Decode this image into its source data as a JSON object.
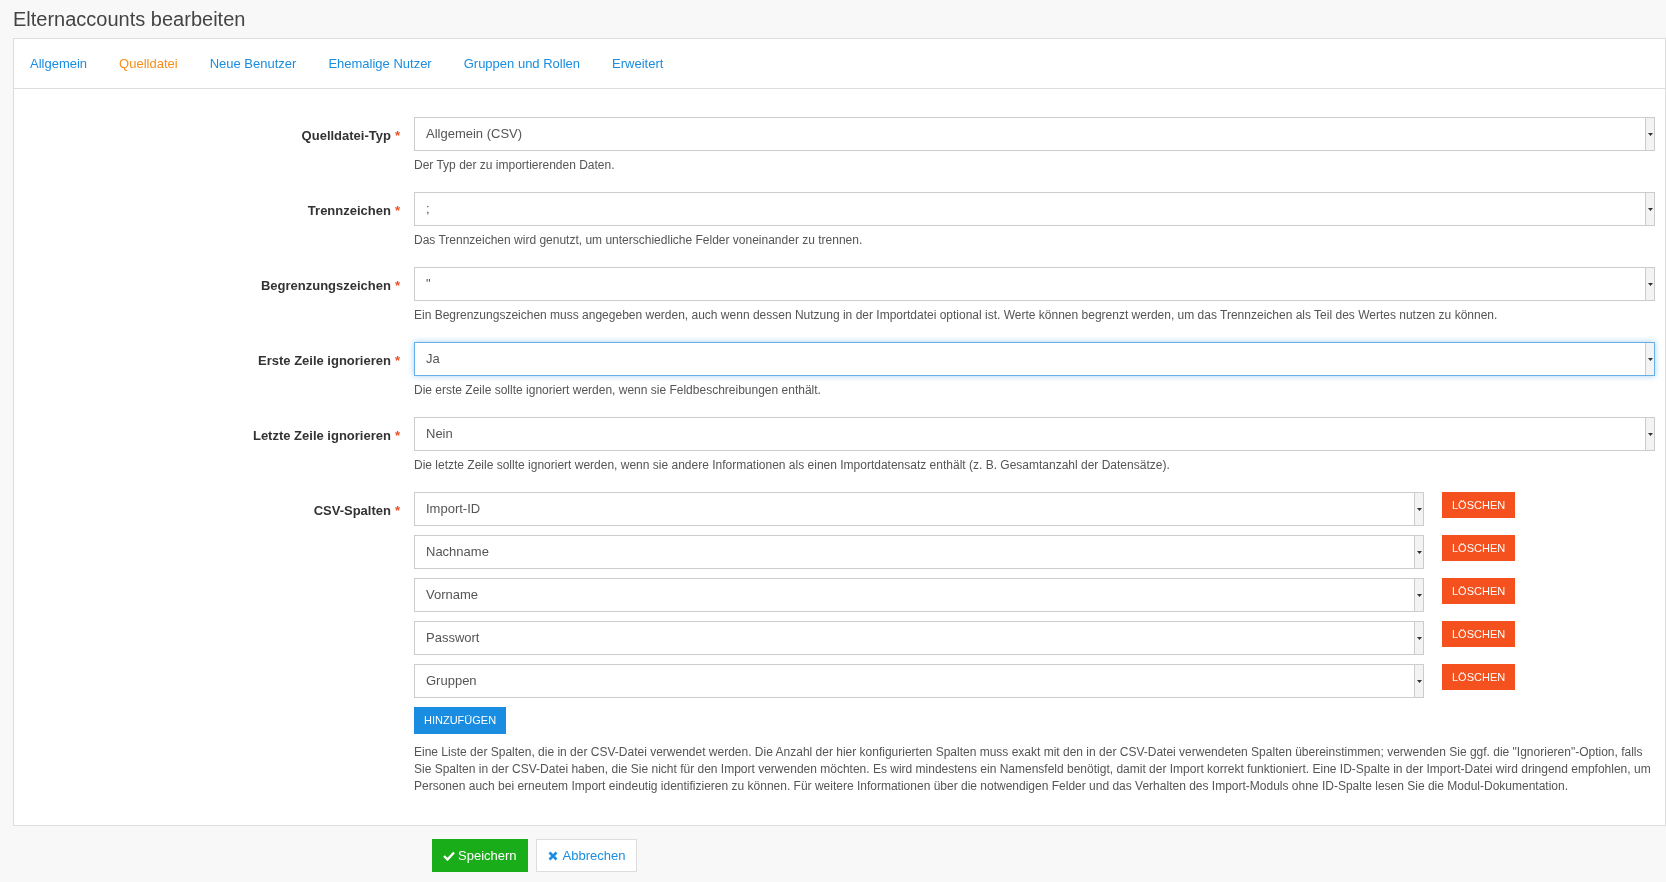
{
  "page_title": "Elternaccounts bearbeiten",
  "tabs": [
    {
      "label": "Allgemein",
      "selected": false
    },
    {
      "label": "Quelldatei",
      "selected": true
    },
    {
      "label": "Neue Benutzer",
      "selected": false
    },
    {
      "label": "Ehemalige Nutzer",
      "selected": false
    },
    {
      "label": "Gruppen und Rollen",
      "selected": false
    },
    {
      "label": "Erweitert",
      "selected": false
    }
  ],
  "fields": [
    {
      "label": "Quelldatei-Typ",
      "required": "*",
      "value": "Allgemein (CSV)",
      "focused": false,
      "help": "Der Typ der zu importierenden Daten."
    },
    {
      "label": "Trennzeichen",
      "required": "*",
      "value": ";",
      "focused": false,
      "help": "Das Trennzeichen wird genutzt, um unterschiedliche Felder voneinander zu trennen."
    },
    {
      "label": "Begrenzungszeichen",
      "required": "*",
      "value": "\"",
      "focused": false,
      "help": "Ein Begrenzungszeichen muss angegeben werden, auch wenn dessen Nutzung in der Importdatei optional ist. Werte können begrenzt werden, um das Trennzeichen als Teil des Wertes nutzen zu können."
    },
    {
      "label": "Erste Zeile ignorieren",
      "required": "*",
      "value": "Ja",
      "focused": true,
      "help": "Die erste Zeile sollte ignoriert werden, wenn sie Feldbeschreibungen enthält."
    },
    {
      "label": "Letzte Zeile ignorieren",
      "required": "*",
      "value": "Nein",
      "focused": false,
      "help": "Die letzte Zeile sollte ignoriert werden, wenn sie andere Informationen als einen Importdatensatz enthält (z. B. Gesamtanzahl der Datensätze)."
    }
  ],
  "csv_columns": {
    "label": "CSV-Spalten",
    "required": "*",
    "rows": [
      {
        "value": "Import-ID",
        "delete_button": "LÖSCHEN"
      },
      {
        "value": "Nachname",
        "delete_button": "LÖSCHEN"
      },
      {
        "value": "Vorname",
        "delete_button": "LÖSCHEN"
      },
      {
        "value": "Passwort",
        "delete_button": "LÖSCHEN"
      },
      {
        "value": "Gruppen",
        "delete_button": "LÖSCHEN"
      }
    ],
    "add_button": "HINZUFÜGEN",
    "help": "Eine Liste der Spalten, die in der CSV-Datei verwendet werden. Die Anzahl der hier konfigurierten Spalten muss exakt mit den in der CSV-Datei verwendeten Spalten übereinstimmen; verwenden Sie ggf. die \"Ignorieren\"-Option, falls Sie Spalten in der CSV-Datei haben, die Sie nicht für den Import verwenden möchten. Es wird mindestens ein Namensfeld benötigt, damit der Import korrekt funktioniert. Eine ID-Spalte in der Import-Datei wird dringend empfohlen, um Personen auch bei erneutem Import eindeutig identifizieren zu können. Für weitere Informationen über die notwendigen Felder und das Verhalten des Import-Moduls ohne ID-Spalte lesen Sie die Modul-Dokumentation."
  },
  "footer_buttons": [
    {
      "kind": "primary",
      "label": "Speichern"
    },
    {
      "kind": "secondary",
      "label": "Abbrechen"
    }
  ]
}
